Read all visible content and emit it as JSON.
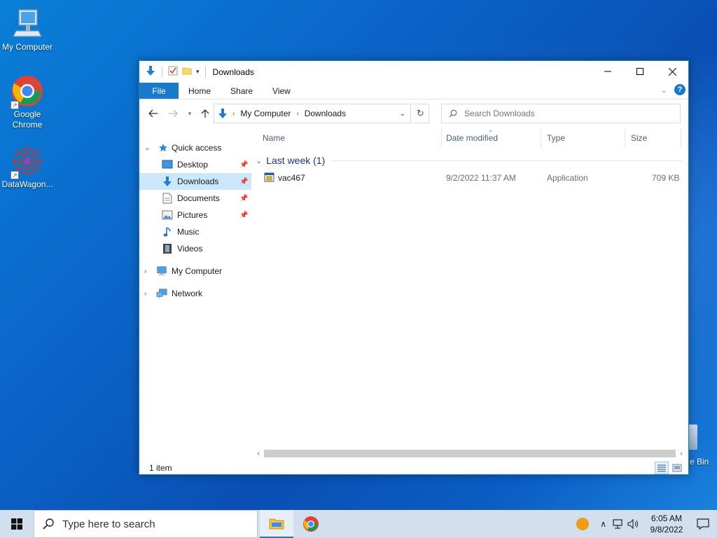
{
  "desktop": {
    "icons": [
      {
        "label": "My Computer"
      },
      {
        "label": "Google Chrome"
      },
      {
        "label": "DataWagon..."
      }
    ],
    "recycle_bin_partial_label": "e Bin"
  },
  "window": {
    "title": "Downloads",
    "ribbon_tabs": [
      "File",
      "Home",
      "Share",
      "View"
    ],
    "address": {
      "crumbs": [
        "My Computer",
        "Downloads"
      ]
    },
    "search": {
      "placeholder": "Search Downloads"
    },
    "nav_pane": {
      "quick_access": "Quick access",
      "quick_items": [
        {
          "label": "Desktop",
          "pinned": true
        },
        {
          "label": "Downloads",
          "pinned": true,
          "selected": true
        },
        {
          "label": "Documents",
          "pinned": true
        },
        {
          "label": "Pictures",
          "pinned": true
        },
        {
          "label": "Music",
          "pinned": false
        },
        {
          "label": "Videos",
          "pinned": false
        }
      ],
      "my_computer": "My Computer",
      "network": "Network"
    },
    "columns": [
      "Name",
      "Date modified",
      "Type",
      "Size"
    ],
    "group": {
      "label": "Last week (1)"
    },
    "files": [
      {
        "name": "vac467",
        "date_modified": "9/2/2022 11:37 AM",
        "type": "Application",
        "size": "709 KB"
      }
    ],
    "status": {
      "item_count": "1 item"
    }
  },
  "taskbar": {
    "search_placeholder": "Type here to search",
    "clock": {
      "time": "6:05 AM",
      "date": "9/8/2022"
    }
  },
  "colors": {
    "accent": "#1979ca",
    "selection": "#cce8ff",
    "group_header": "#1e3287",
    "taskbar": "#d2dfef"
  }
}
